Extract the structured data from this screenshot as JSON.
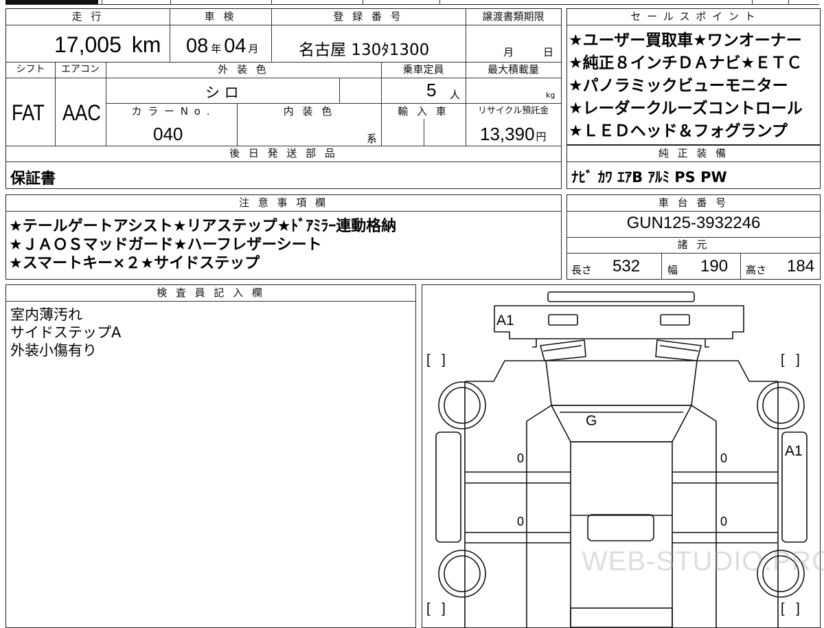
{
  "header": {
    "mileage_label": "走 行",
    "inspection_label": "車 検",
    "registration_label": "登 録 番 号",
    "transfer_deadline_label": "譲渡書類期限",
    "shift_label": "シフト",
    "aircon_label": "エアコン",
    "exterior_color_label": "外 装 色",
    "capacity_label": "乗車定員",
    "max_load_label": "最大積載量",
    "color_no_label": "カ ラ ー N o .",
    "interior_color_label": "内 装 色",
    "import_label": "輸 入 車",
    "recycle_label": "リサイクル預託金",
    "later_parts_label": "後 日 発 送 部 品"
  },
  "values": {
    "mileage": "17,005",
    "mileage_unit": "km",
    "inspection_year": "08",
    "inspection_year_unit": "年",
    "inspection_month": "04",
    "inspection_month_unit": "月",
    "registration_number": "名古屋 130ﾀ1300",
    "deadline_month_unit": "月",
    "deadline_day_unit": "日",
    "shift": "FAT",
    "aircon": "AAC",
    "exterior_color": "シ ロ",
    "capacity": "5",
    "capacity_unit": "人",
    "max_load_unit": "kg",
    "color_no": "040",
    "interior_color_suffix": "系",
    "recycle_amount": "13,390",
    "recycle_unit": "円",
    "later_parts": "保証書"
  },
  "sales_points": {
    "title": "セ ー ル ス ポ イ ン ト",
    "lines": [
      "★ユーザー買取車★ワンオーナー",
      "★純正８インチＤＡナビ★ＥＴＣ",
      "★パノラミックビューモニター",
      "★レーダークルーズコントロール",
      "★ＬＥＤヘッド＆フォグランプ"
    ]
  },
  "equipment": {
    "title": "純 正 装 備",
    "value": "ﾅﾋﾞ ｶﾜ ｴｱB ｱﾙﾐ PS PW"
  },
  "notes": {
    "title": "注 意 事 項 欄",
    "lines": [
      "★テールゲートアシスト★リアステップ★ﾄﾞｱﾐﾗｰ連動格納",
      "★ＪＡＯＳマッドガード★ハーフレザーシート",
      "★スマートキー×２★サイドステップ"
    ]
  },
  "chassis": {
    "title": "車 台 番 号",
    "value": "GUN125-3932246"
  },
  "specs": {
    "title": "諸 元",
    "length_label": "長さ",
    "length": "532",
    "width_label": "幅",
    "width": "190",
    "height_label": "高さ",
    "height": "184"
  },
  "inspector": {
    "title": "検 査 員 記 入 欄",
    "lines": [
      "室内薄汚れ",
      "サイドステップA",
      "外装小傷有り"
    ]
  },
  "diagram": {
    "marks": {
      "front_bumper": "A1",
      "windshield": "G",
      "right_side": "A1",
      "door_zero": "0"
    },
    "bracket_text": "[   ]",
    "watermark": "WEB-STUDIO.PRO"
  }
}
